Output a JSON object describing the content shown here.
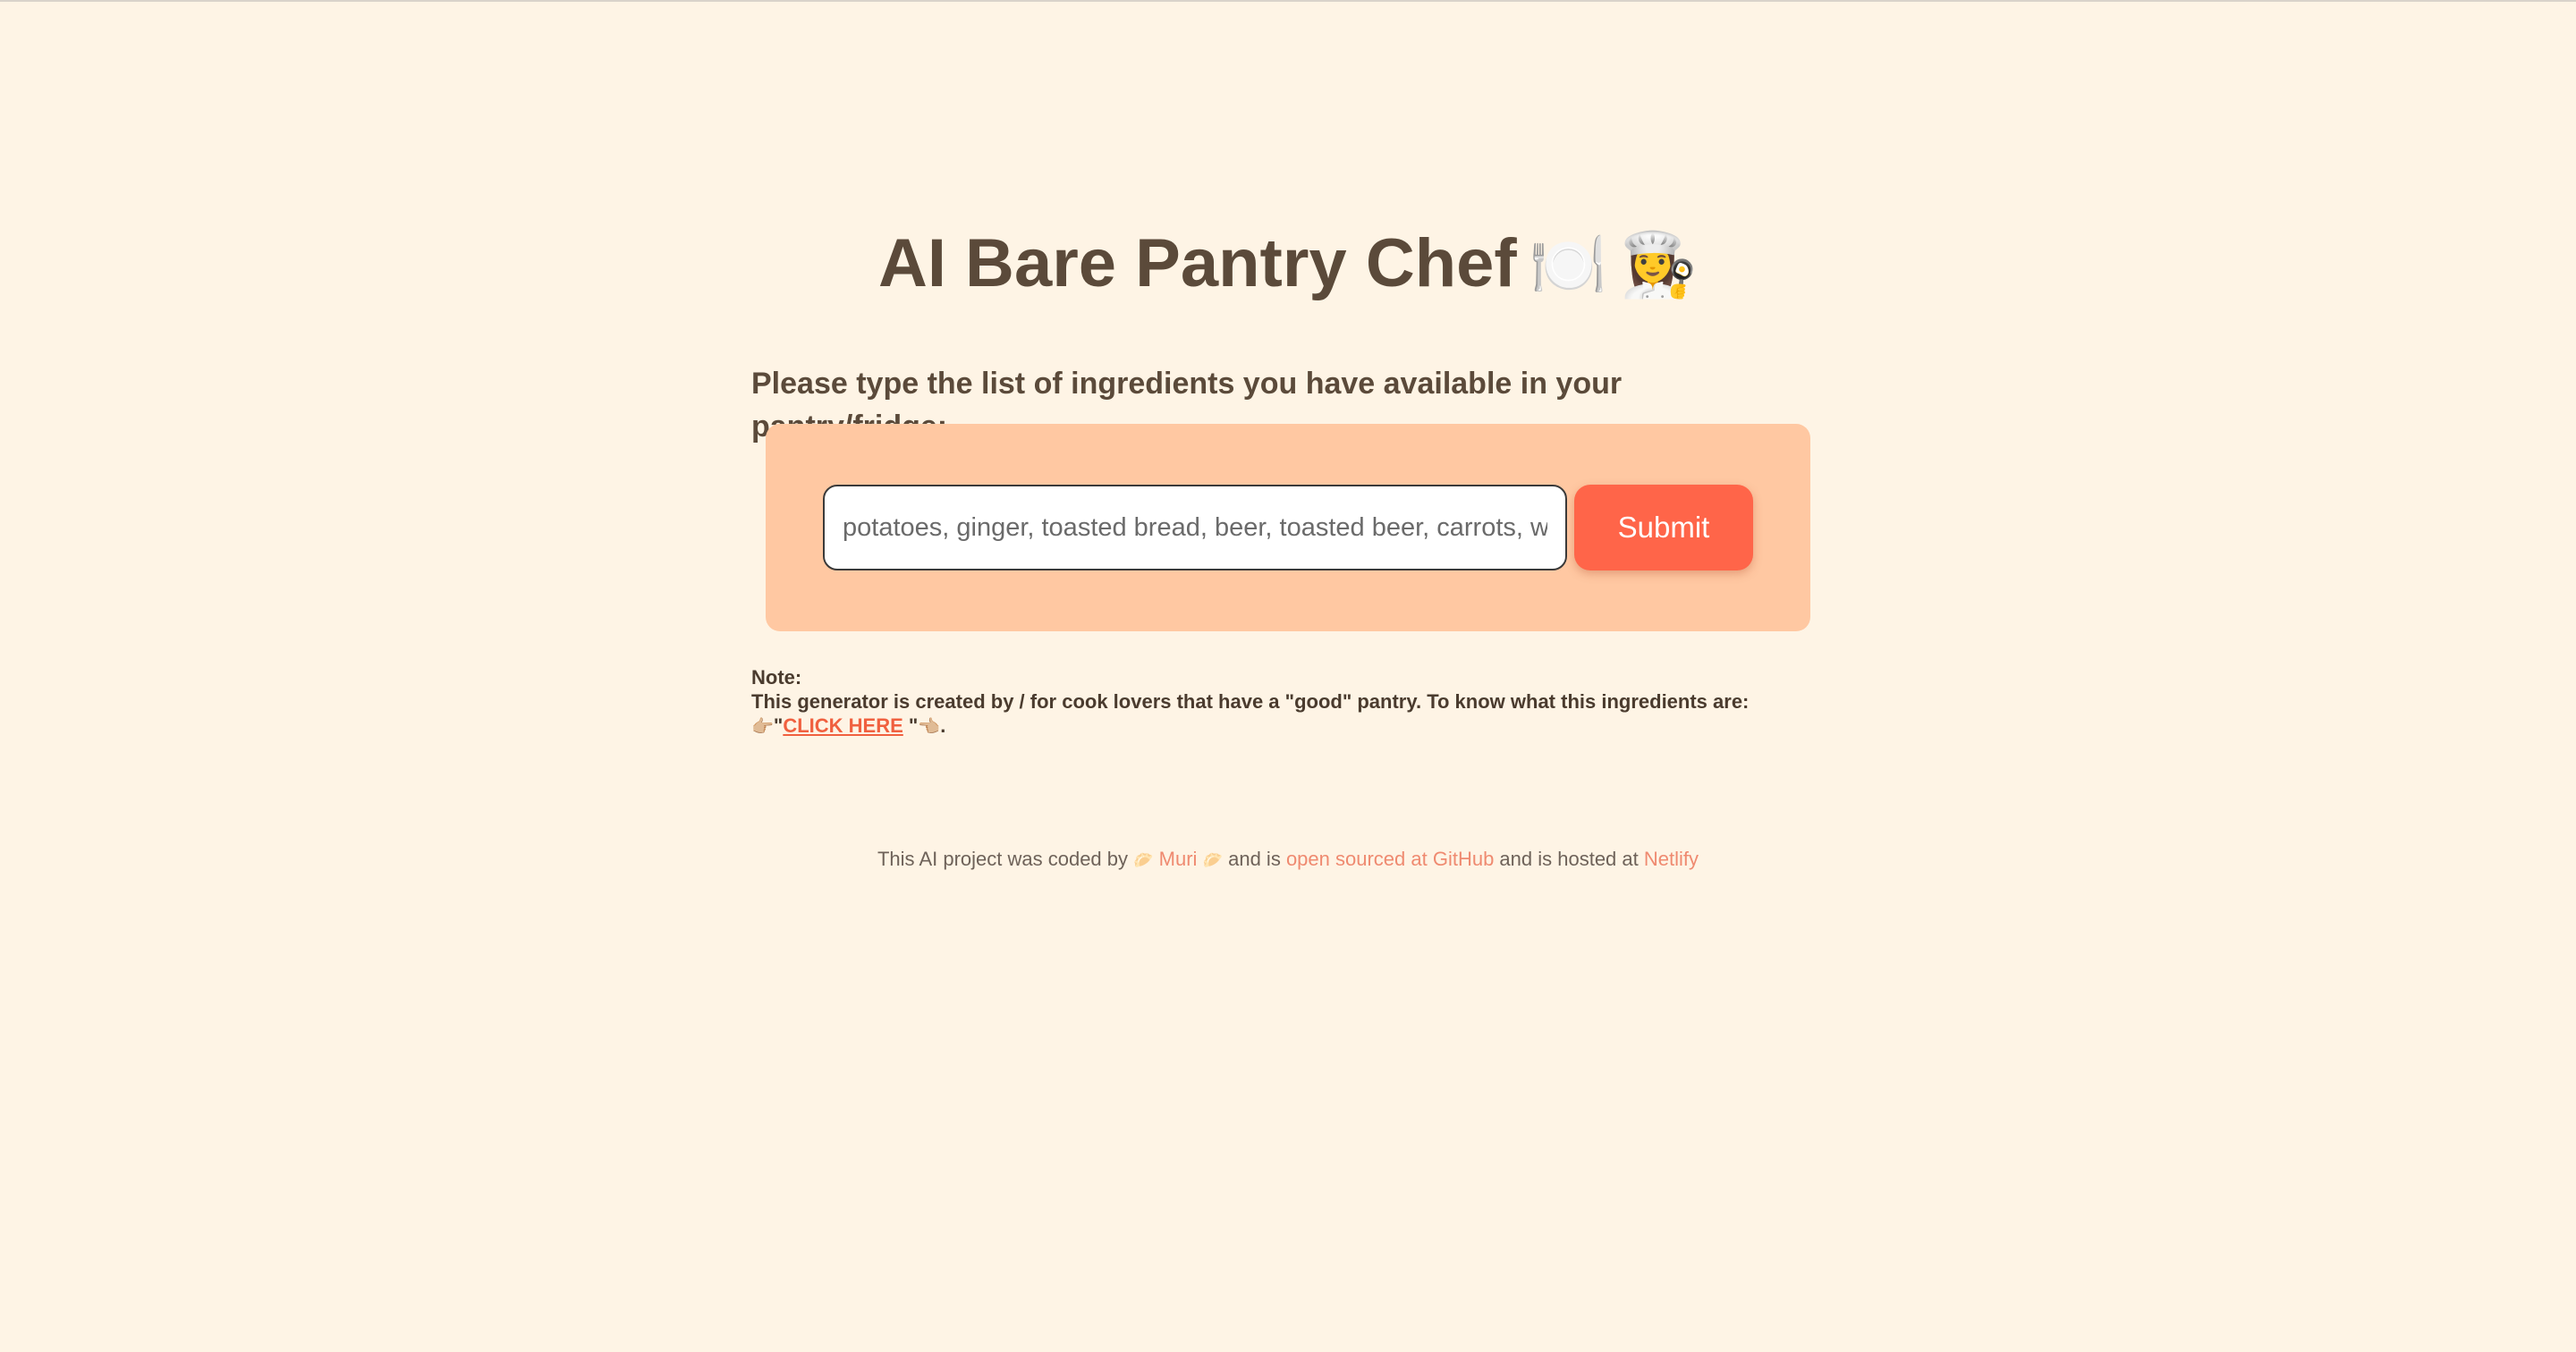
{
  "page": {
    "title": "AI Bare Pantry Chef",
    "title_icons": [
      "🍽️",
      "👩‍🍳"
    ],
    "prompt": "Please type the list of ingredients you have available in your pantry/fridge:"
  },
  "form": {
    "input_value": "",
    "input_placeholder": "potatoes, ginger, toasted bread, beer, toasted beer, carrots, wine ...",
    "submit_label": "Submit"
  },
  "note": {
    "heading": "Note:",
    "body": "This generator is created by / for cook lovers that have a \"good\" pantry. To know what this ingredients are:",
    "pointer_left": "👉🏼",
    "open_quote": "\"",
    "link_label": "CLICK HERE",
    "close_quote": " \"",
    "pointer_right": "👈🏼",
    "end": "."
  },
  "footer": {
    "prefix": "This AI project was coded by ",
    "emoji": "🥟",
    "author_link": "Muri",
    "middle": " and is ",
    "github_link": "open sourced at GitHub",
    "hosted_text": " and is hosted at ",
    "netlify_link": "Netlify"
  },
  "colors": {
    "background": "#fef4e5",
    "text": "#5b4a3a",
    "form_box": "#ffc8a2",
    "submit_button": "#ff6549",
    "link": "#f0603f",
    "footer_link": "#ef8a70"
  },
  "icons": {
    "title_icons": [
      "plate-cutlery-icon",
      "woman-cook-icon"
    ],
    "note_icons": [
      "pointing-right-hand-icon",
      "pointing-left-hand-icon"
    ],
    "footer_icon": "dumpling-icon"
  }
}
